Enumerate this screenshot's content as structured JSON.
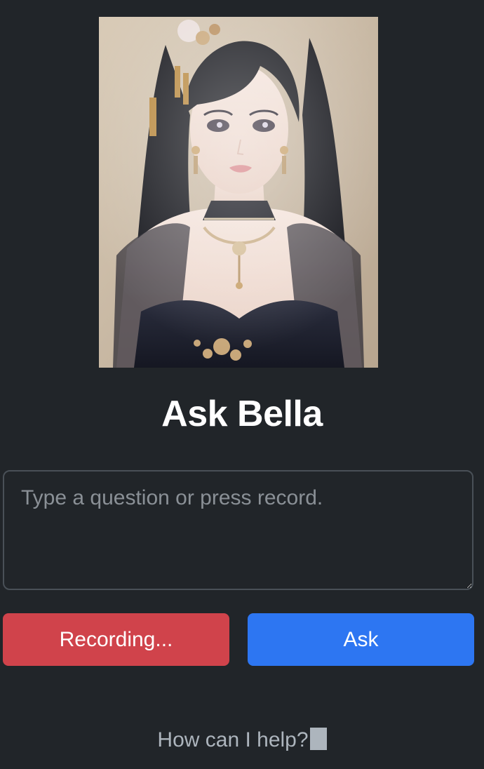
{
  "portrait": {
    "alt": "Bella portrait"
  },
  "header": {
    "title": "Ask Bella"
  },
  "question": {
    "value": "",
    "placeholder": "Type a question or press record."
  },
  "actions": {
    "record_label": "Recording...",
    "ask_label": "Ask"
  },
  "response": {
    "text": "How can I help?"
  },
  "colors": {
    "background": "#212529",
    "record_button": "#d0434b",
    "ask_button": "#2d76f2",
    "muted_text": "#adb5bd"
  }
}
